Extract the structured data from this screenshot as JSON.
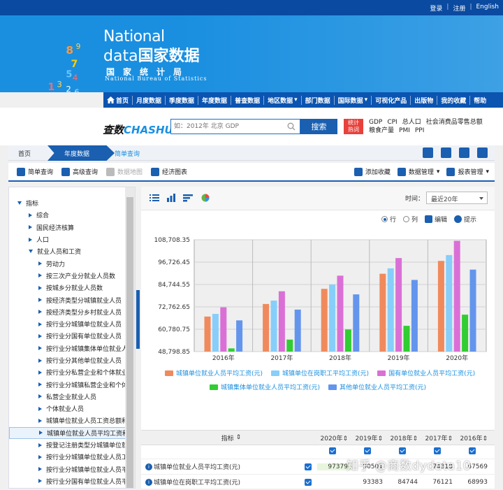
{
  "topbar": {
    "login": "登录",
    "register": "注册",
    "english": "English"
  },
  "logo": {
    "line1": "National",
    "line2a": "data",
    "line2b": "国家数据",
    "line3": "国家统计局",
    "line4": "National Bureau of Statistics"
  },
  "mainnav": {
    "items": [
      {
        "label": "首页"
      },
      {
        "label": "月度数据"
      },
      {
        "label": "季度数据"
      },
      {
        "label": "年度数据"
      },
      {
        "label": "普查数据"
      },
      {
        "label": "地区数据"
      },
      {
        "label": "部门数据"
      },
      {
        "label": "国际数据"
      },
      {
        "label": "可视化产品"
      },
      {
        "label": "出版物"
      },
      {
        "label": "我的收藏"
      },
      {
        "label": "帮助"
      }
    ]
  },
  "search": {
    "brand_a": "查数",
    "brand_b": "CHASHU",
    "placeholder": "如：2012年 北京 GDP",
    "button": "搜索",
    "hot_label_1": "统计",
    "hot_label_2": "热词",
    "hot_words": [
      "GDP",
      "CPI",
      "总人口",
      "社会消费品零售总额",
      "粮食产量",
      "PMI",
      "PPI"
    ]
  },
  "breadcrumb": {
    "home": "首页",
    "annual": "年度数据",
    "simple": "简单查询"
  },
  "toolbar": {
    "simple_query": "简单查询",
    "advanced_query": "高级查询",
    "data_map": "数据地图",
    "econ_chart": "经济图表",
    "add_favorite": "添加收藏",
    "data_manage": "数据管理",
    "report_manage": "报表管理"
  },
  "tree": {
    "root": "指标",
    "items": [
      {
        "label": "综合",
        "level": 1,
        "expanded": false
      },
      {
        "label": "国民经济核算",
        "level": 1,
        "expanded": false
      },
      {
        "label": "人口",
        "level": 1,
        "expanded": false
      },
      {
        "label": "就业人员和工资",
        "level": 1,
        "expanded": true
      },
      {
        "label": "劳动力",
        "level": 2
      },
      {
        "label": "按三次产业分就业人员数",
        "level": 2
      },
      {
        "label": "按城乡分就业人员数",
        "level": 2
      },
      {
        "label": "按经济类型分城镇就业人员",
        "level": 2
      },
      {
        "label": "按经济类型分乡村就业人员",
        "level": 2
      },
      {
        "label": "按行业分城镇单位就业人员",
        "level": 2
      },
      {
        "label": "按行业分国有单位就业人员",
        "level": 2
      },
      {
        "label": "按行业分城镇集体单位就业人",
        "level": 2
      },
      {
        "label": "按行业分其他单位就业人员",
        "level": 2
      },
      {
        "label": "按行业分私营企业和个体就业",
        "level": 2
      },
      {
        "label": "按行业分城镇私营企业和个体",
        "level": 2
      },
      {
        "label": "私营企业就业人员",
        "level": 2
      },
      {
        "label": "个体就业人员",
        "level": 2
      },
      {
        "label": "城镇单位就业人员工资总额和",
        "level": 2
      },
      {
        "label": "城镇单位就业人员平均工资和",
        "level": 2,
        "selected": true
      },
      {
        "label": "按登记注册类型分城镇单位就",
        "level": 2
      },
      {
        "label": "按行业分城镇单位就业人员工",
        "level": 2
      },
      {
        "label": "按行业分城镇单位就业人员平",
        "level": 2
      },
      {
        "label": "按行业分国有单位就业人员平",
        "level": 2
      }
    ]
  },
  "controls": {
    "time_label": "时间：",
    "time_value": "最近20年",
    "row": "行",
    "col": "列",
    "edit": "编辑",
    "tip": "提示"
  },
  "chart_data": {
    "type": "bar",
    "categories": [
      "2016年",
      "2017年",
      "2018年",
      "2019年",
      "2020年"
    ],
    "ylim": [
      48798.85,
      108708.35
    ],
    "yticks": [
      "48,798.85",
      "60,780.75",
      "72,762.65",
      "84,744.55",
      "96,726.45",
      "108,708.35"
    ],
    "series": [
      {
        "name": "城镇单位就业人员平均工资(元)",
        "color": "#f08a5d",
        "values": [
          67569,
          74318,
          82413,
          90501,
          97379
        ]
      },
      {
        "name": "城镇单位在岗职工平均工资(元)",
        "color": "#87cefa",
        "values": [
          68993,
          76121,
          84744,
          93383,
          100512
        ]
      },
      {
        "name": "国有单位就业人员平均工资(元)",
        "color": "#da70d6",
        "values": [
          72538,
          81114,
          89474,
          98899,
          108132
        ]
      },
      {
        "name": "城镇集体单位就业人员平均工资(元)",
        "color": "#32cd32",
        "values": [
          50527,
          55243,
          60664,
          62612,
          68590
        ]
      },
      {
        "name": "其他单位就业人员平均工资(元)",
        "color": "#6495ed",
        "values": [
          65531,
          71304,
          79453,
          87195,
          92721
        ]
      }
    ],
    "grid": true,
    "legend_position": "bottom"
  },
  "table": {
    "header_indicator": "指标",
    "years": [
      "2020年",
      "2019年",
      "2018年",
      "2017年",
      "2016年"
    ],
    "rows": [
      {
        "name": "城镇单位就业人员平均工资(元)",
        "values": [
          "97379",
          "90501",
          "",
          "74318",
          "67569"
        ]
      },
      {
        "name": "城镇单位在岗职工平均工资(元)",
        "values": [
          "",
          "93383",
          "84744",
          "76121",
          "68993"
        ]
      }
    ]
  },
  "watermark": "知乎 @商数dydata10"
}
